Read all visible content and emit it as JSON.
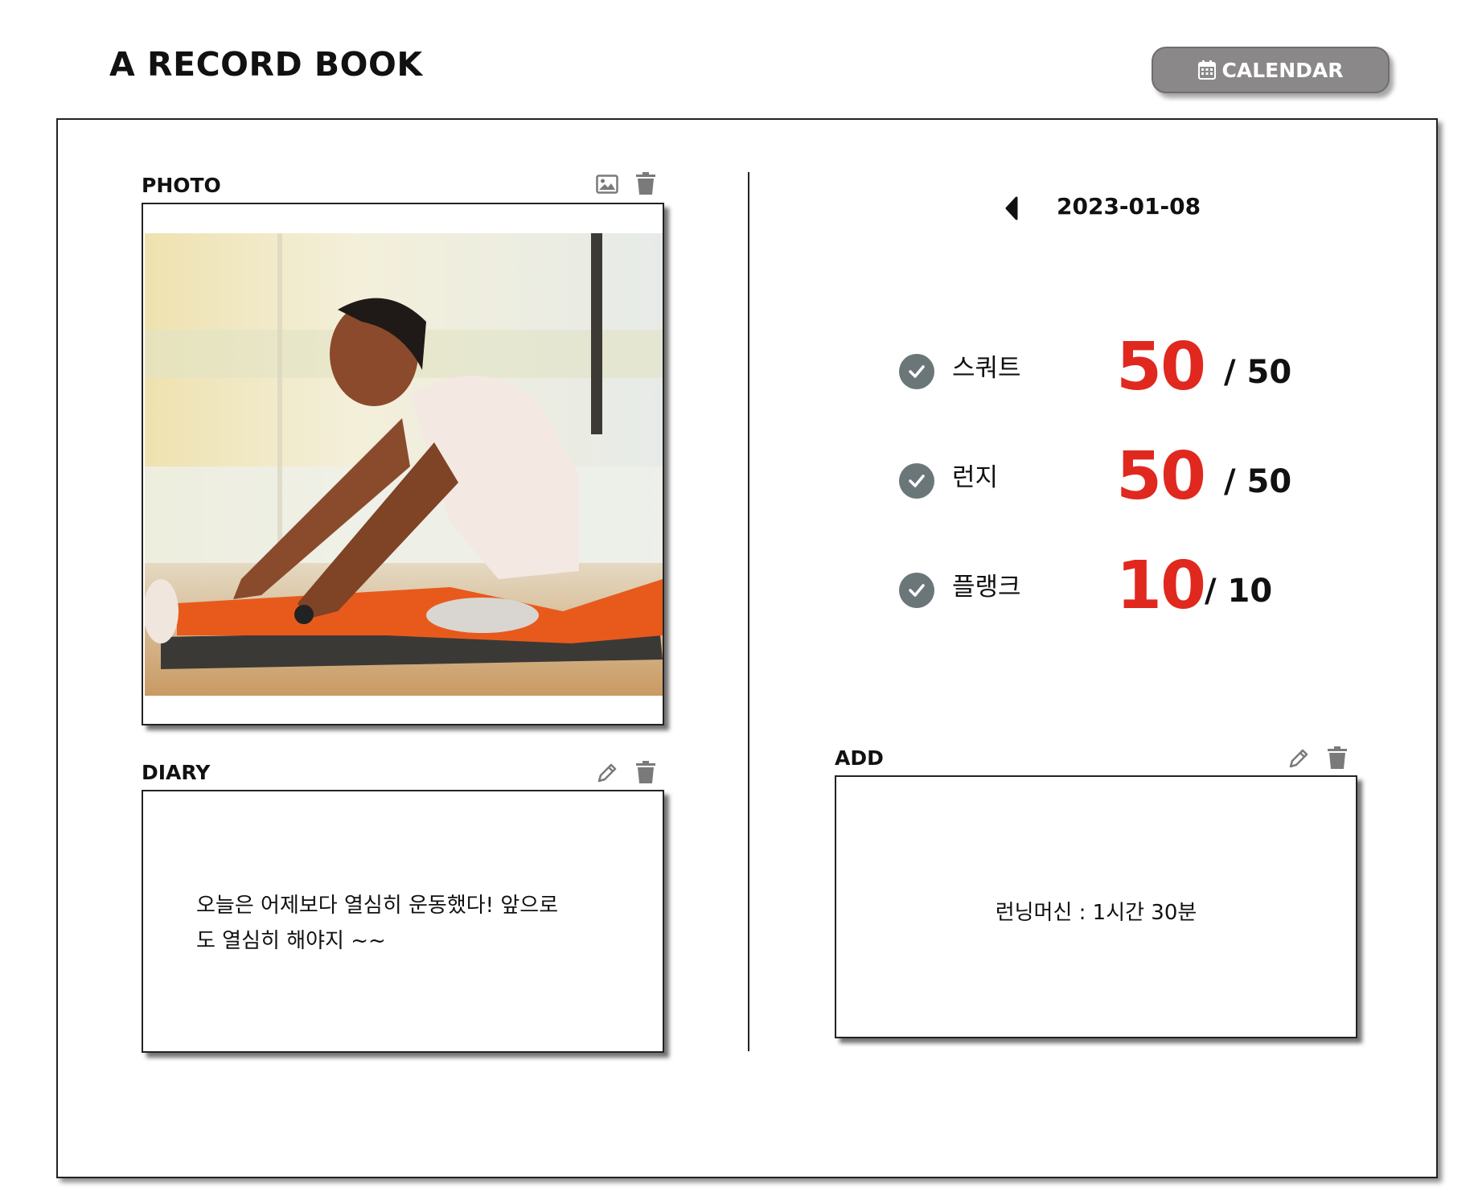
{
  "header": {
    "title": "A RECORD BOOK",
    "calendar_button": {
      "label": "CALENDAR",
      "icon": "calendar-icon"
    }
  },
  "photo_section": {
    "label": "PHOTO",
    "icons": [
      "image-icon",
      "trash-icon"
    ]
  },
  "diary_section": {
    "label": "DIARY",
    "icons": [
      "pencil-icon",
      "trash-icon"
    ],
    "line1": "오늘은 어제보다 열심히 운동했다! 앞으로",
    "line2": "도 열심히 해야지 ~~"
  },
  "date_nav": {
    "prev_icon": "caret-left-icon",
    "date": "2023-01-08"
  },
  "exercises": [
    {
      "name": "스쿼트",
      "done": "50",
      "target": "/ 50",
      "status_icon": "check-circle-icon"
    },
    {
      "name": "런지",
      "done": "50",
      "target": "/ 50",
      "status_icon": "check-circle-icon"
    },
    {
      "name": "플랭크",
      "done": "10",
      "target": "/ 10",
      "status_icon": "check-circle-icon"
    }
  ],
  "add_section": {
    "label": "ADD",
    "icons": [
      "pencil-icon",
      "trash-icon"
    ],
    "text": "런닝머신 : 1시간 30분"
  },
  "colors": {
    "accent_red": "#e0281f",
    "button_gray": "#8a8888",
    "check_gray": "#6b7678"
  }
}
